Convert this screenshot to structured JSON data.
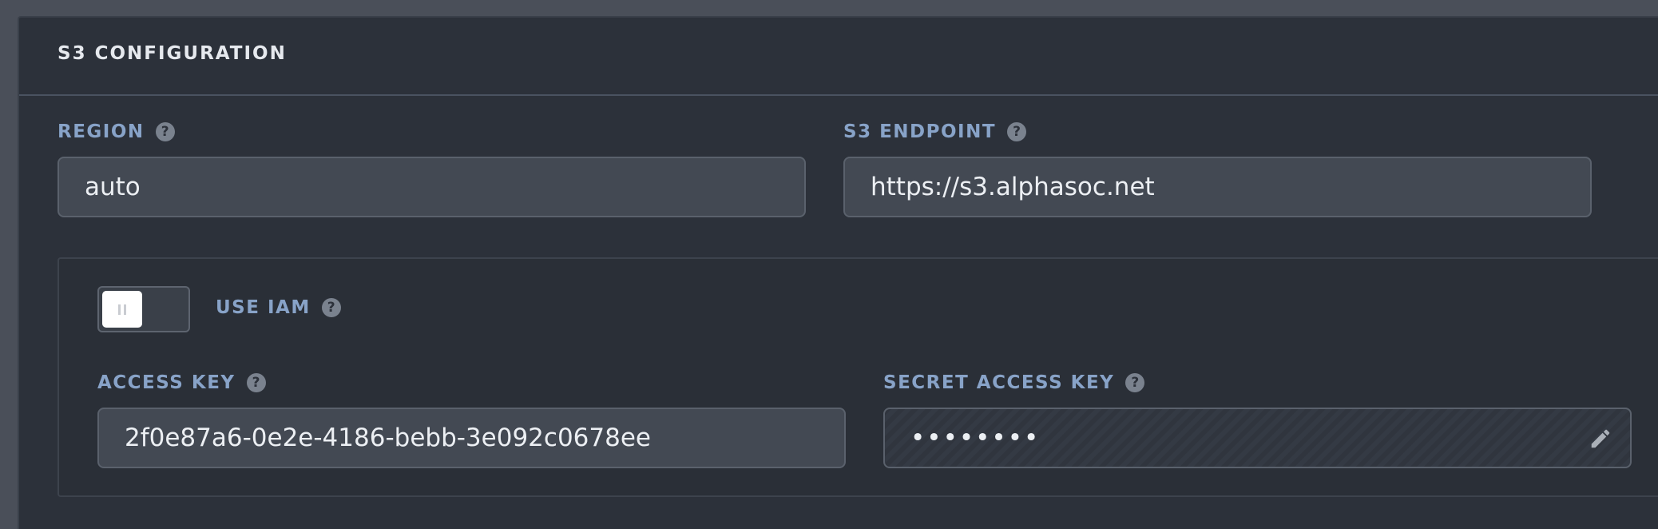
{
  "section": {
    "title": "S3 CONFIGURATION"
  },
  "region": {
    "label": "REGION",
    "value": "auto"
  },
  "endpoint": {
    "label": "S3 ENDPOINT",
    "value": "https://s3.alphasoc.net"
  },
  "use_iam": {
    "label": "USE IAM",
    "enabled": false
  },
  "access_key": {
    "label": "ACCESS KEY",
    "value": "2f0e87a6-0e2e-4186-bebb-3e092c0678ee"
  },
  "secret_access_key": {
    "label": "SECRET ACCESS KEY",
    "masked_value": "••••••••",
    "edit_icon": "pencil-icon"
  },
  "icons": {
    "help": "?"
  },
  "colors": {
    "label": "#88a3c8",
    "panel_bg": "#2c313a",
    "input_bg": "#434953"
  }
}
